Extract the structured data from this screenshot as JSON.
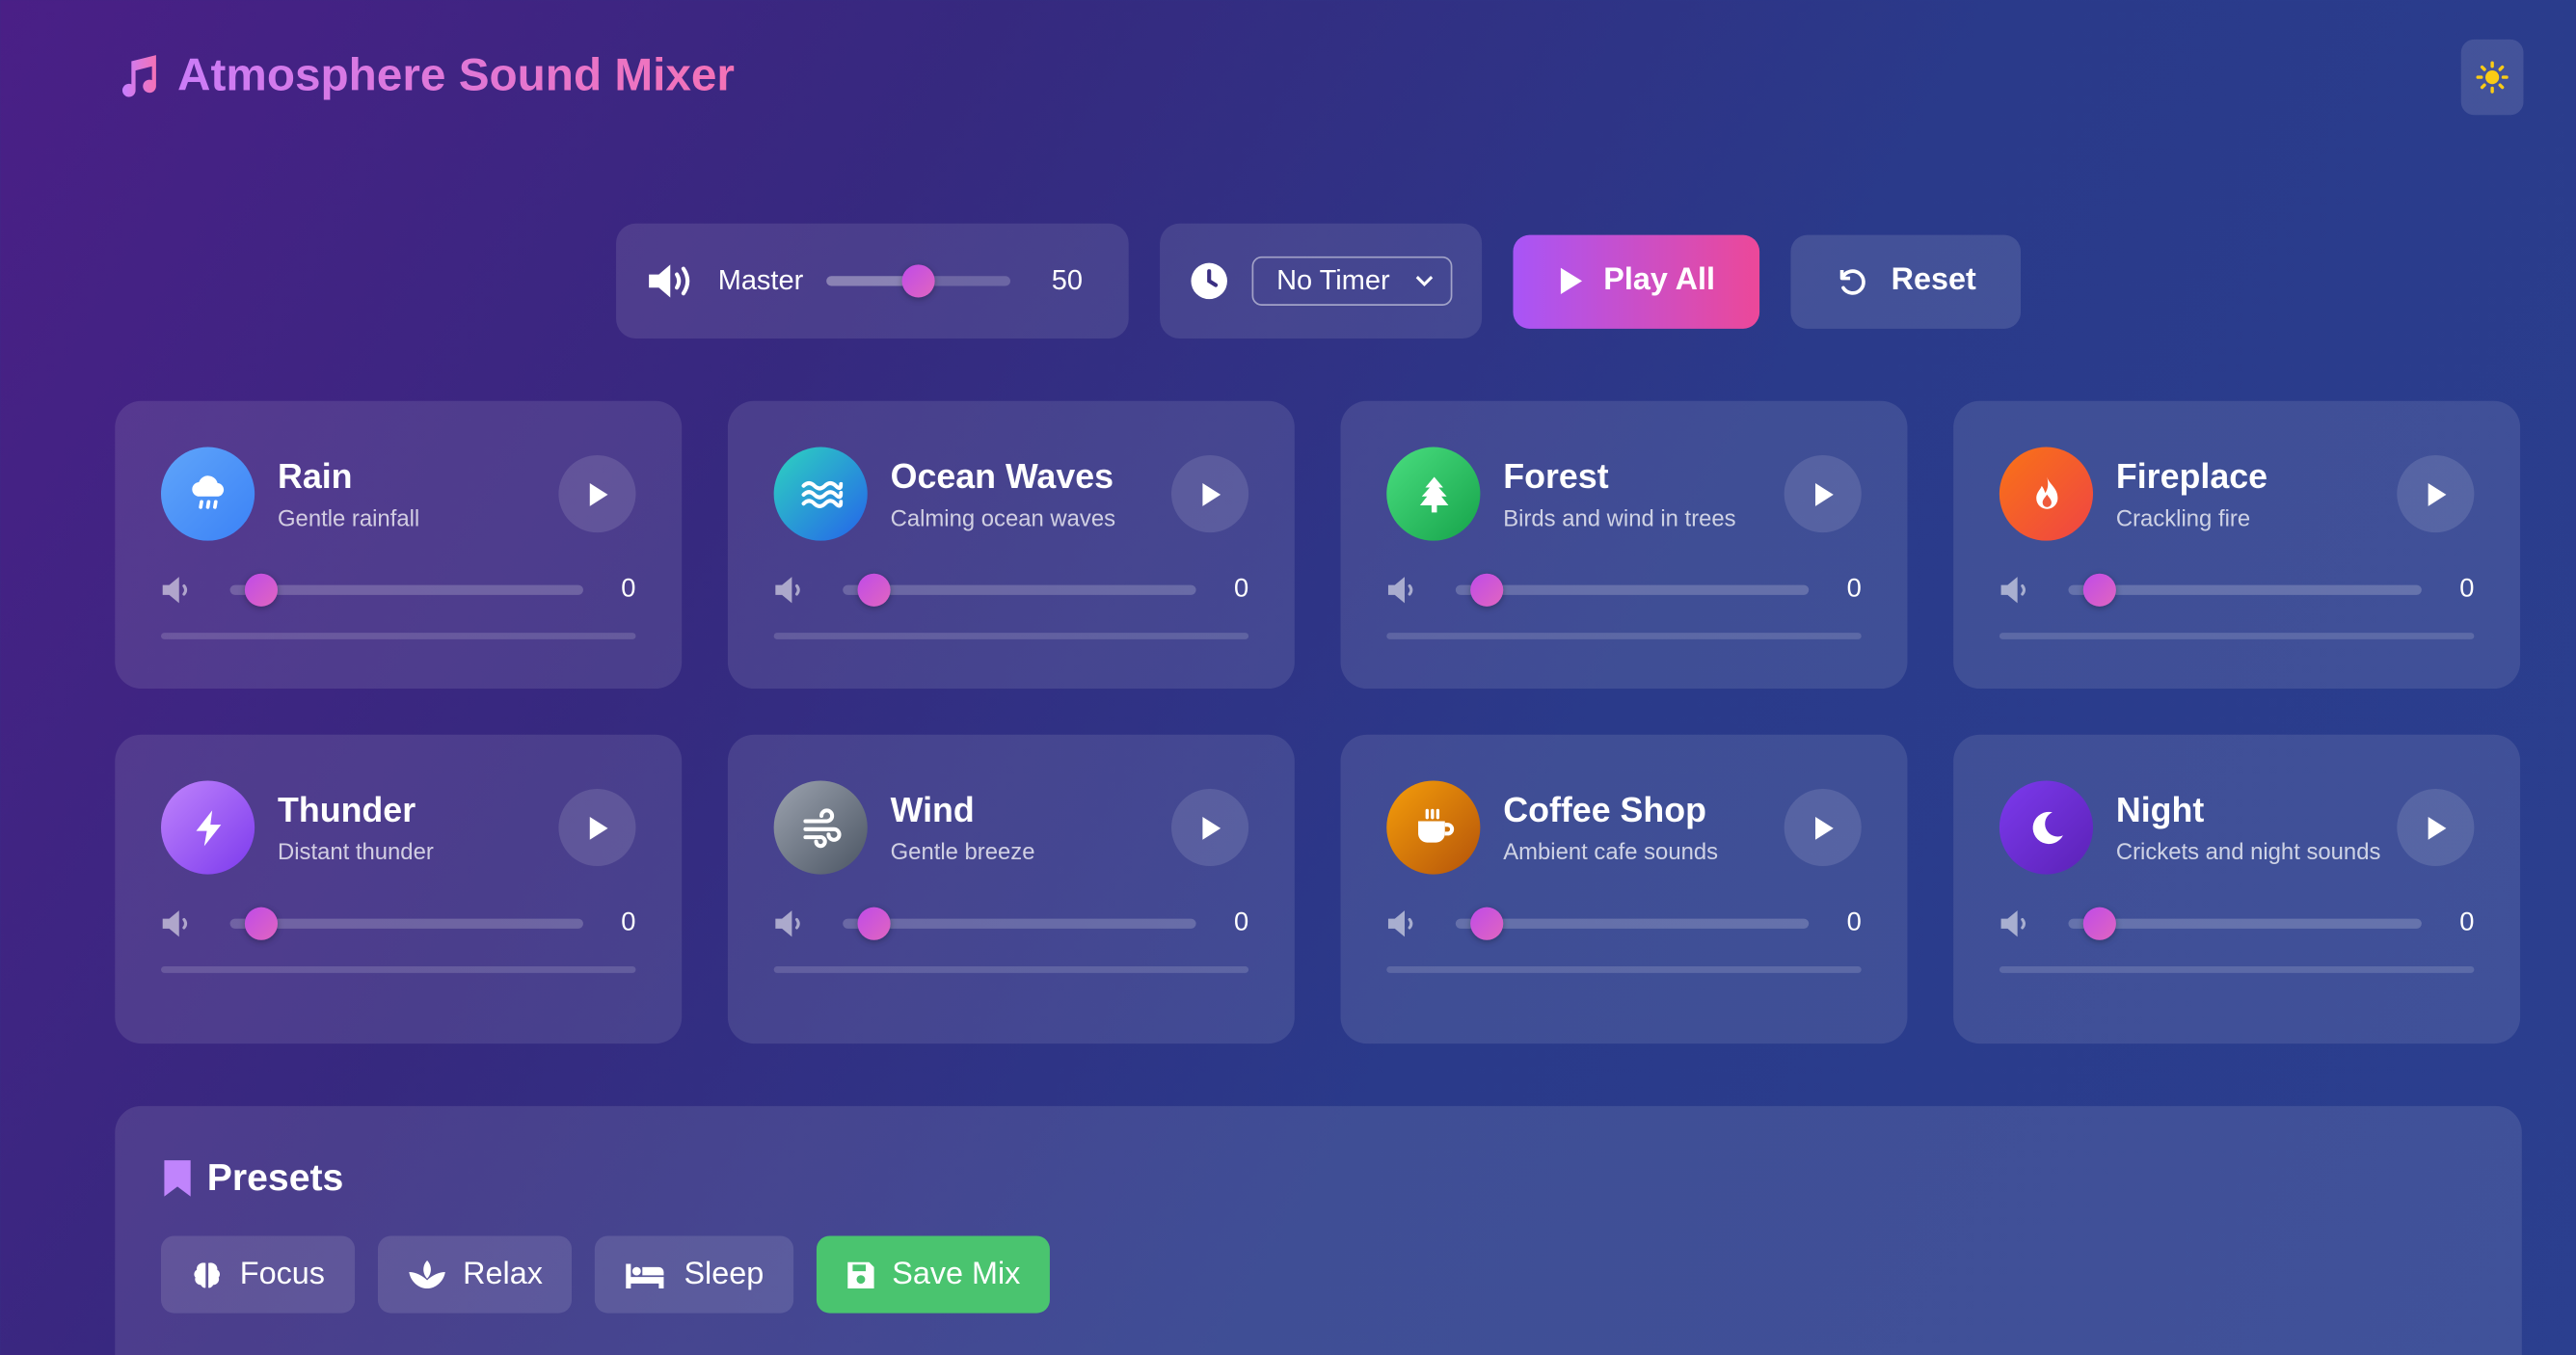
{
  "app": {
    "title": "Atmosphere Sound Mixer"
  },
  "controls": {
    "master_label": "Master",
    "master_value": "50",
    "master_level": 0.5,
    "timer_selected": "No Timer",
    "play_all_label": "Play All",
    "reset_label": "Reset"
  },
  "sounds": [
    {
      "name": "Rain",
      "desc": "Gentle rainfall",
      "volume": "0",
      "icon": "cloud-rain-icon",
      "color": "#3b82f6"
    },
    {
      "name": "Ocean Waves",
      "desc": "Calming ocean waves",
      "volume": "0",
      "icon": "water-icon",
      "color": "#22a6c4"
    },
    {
      "name": "Forest",
      "desc": "Birds and wind in trees",
      "volume": "0",
      "icon": "tree-icon",
      "color": "#22c55e"
    },
    {
      "name": "Fireplace",
      "desc": "Crackling fire",
      "volume": "0",
      "icon": "fire-icon",
      "color": "#ef4444"
    },
    {
      "name": "Thunder",
      "desc": "Distant thunder",
      "volume": "0",
      "icon": "bolt-icon",
      "color": "#8b5cf6"
    },
    {
      "name": "Wind",
      "desc": "Gentle breeze",
      "volume": "0",
      "icon": "wind-icon",
      "color": "#6b7280"
    },
    {
      "name": "Coffee Shop",
      "desc": "Ambient cafe sounds",
      "volume": "0",
      "icon": "coffee-icon",
      "color": "#d97706"
    },
    {
      "name": "Night",
      "desc": "Crickets and night sounds",
      "volume": "0",
      "icon": "moon-icon",
      "color": "#6d28d9"
    }
  ],
  "presets": {
    "title": "Presets",
    "items": [
      "Focus",
      "Relax",
      "Sleep"
    ],
    "save_label": "Save Mix"
  },
  "colors": {
    "accent_start": "#a855f7",
    "accent_end": "#ec4899",
    "save_green": "#4ac46f",
    "sun_yellow": "#facc15"
  }
}
